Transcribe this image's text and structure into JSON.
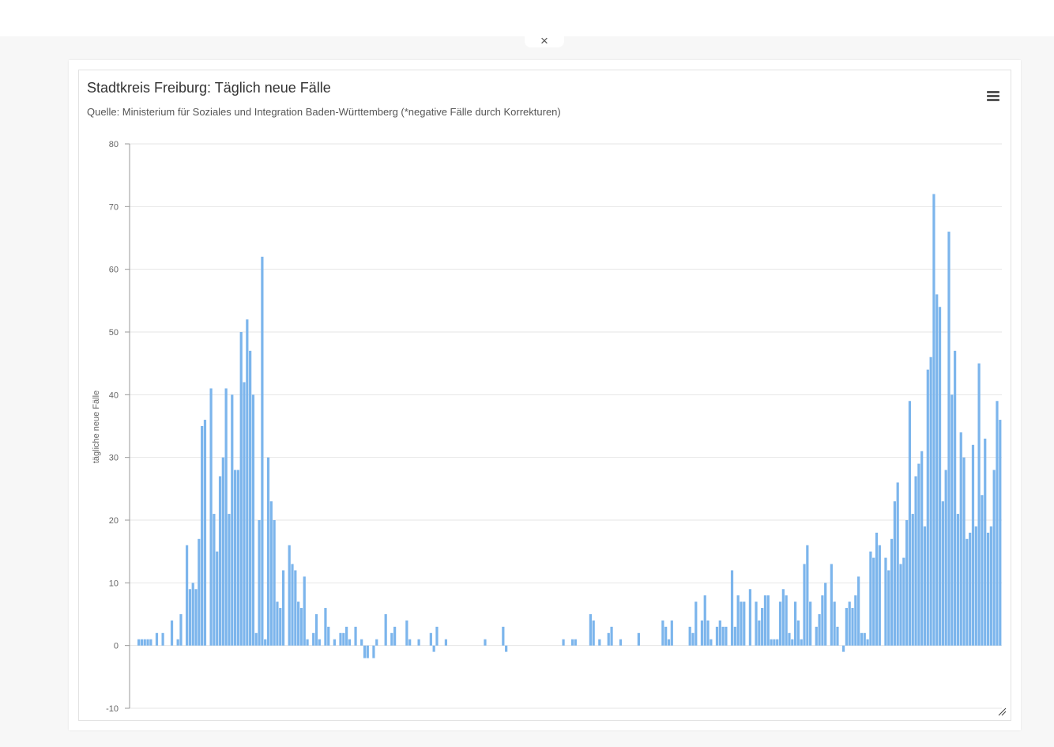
{
  "window": {
    "close_label": "×"
  },
  "menu": {
    "icon": "hamburger-menu-icon"
  },
  "colors": {
    "bar": "#7cb5ec",
    "grid": "#e6e6e6",
    "axis": "#666666"
  },
  "chart_data": {
    "type": "bar",
    "title": "Stadtkreis Freiburg: Täglich neue Fälle",
    "subtitle": "Quelle: Ministerium für Soziales und Integration Baden-Württemberg (*negative Fälle durch Korrekturen)",
    "ylabel": "tägliche neue Fälle",
    "xlabel": "",
    "ylim": [
      -10,
      80
    ],
    "yticks": [
      -10,
      0,
      10,
      20,
      30,
      40,
      50,
      60,
      70,
      80
    ],
    "grid": true,
    "legend": "none",
    "values": [
      1,
      1,
      1,
      1,
      1,
      0,
      2,
      0,
      2,
      0,
      0,
      4,
      0,
      1,
      5,
      0,
      16,
      9,
      10,
      9,
      17,
      35,
      36,
      0,
      41,
      21,
      15,
      27,
      30,
      41,
      21,
      40,
      28,
      28,
      50,
      42,
      52,
      47,
      40,
      2,
      20,
      62,
      1,
      30,
      23,
      20,
      7,
      6,
      12,
      0,
      16,
      13,
      12,
      7,
      6,
      11,
      1,
      0,
      2,
      5,
      1,
      0,
      6,
      3,
      0,
      1,
      0,
      2,
      2,
      3,
      1,
      0,
      3,
      0,
      1,
      -2,
      -2,
      0,
      -2,
      1,
      0,
      0,
      5,
      0,
      2,
      3,
      0,
      0,
      0,
      4,
      1,
      0,
      0,
      1,
      0,
      0,
      0,
      2,
      -1,
      3,
      0,
      0,
      1,
      0,
      0,
      0,
      0,
      0,
      0,
      0,
      0,
      0,
      0,
      0,
      0,
      1,
      0,
      0,
      0,
      0,
      0,
      3,
      -1,
      0,
      0,
      0,
      0,
      0,
      0,
      0,
      0,
      0,
      0,
      0,
      0,
      0,
      0,
      0,
      0,
      0,
      0,
      1,
      0,
      0,
      1,
      1,
      0,
      0,
      0,
      0,
      5,
      4,
      0,
      1,
      0,
      0,
      2,
      3,
      0,
      0,
      1,
      0,
      0,
      0,
      0,
      0,
      2,
      0,
      0,
      0,
      0,
      0,
      0,
      0,
      4,
      3,
      1,
      4,
      0,
      0,
      0,
      0,
      0,
      3,
      2,
      7,
      0,
      4,
      8,
      4,
      1,
      0,
      3,
      4,
      3,
      3,
      0,
      12,
      3,
      8,
      7,
      7,
      0,
      9,
      0,
      7,
      4,
      6,
      8,
      8,
      1,
      1,
      1,
      7,
      9,
      8,
      2,
      1,
      7,
      4,
      1,
      13,
      16,
      7,
      0,
      3,
      5,
      8,
      10,
      0,
      13,
      7,
      3,
      0,
      -1,
      6,
      7,
      6,
      8,
      11,
      2,
      2,
      1,
      15,
      14,
      18,
      16,
      0,
      14,
      12,
      17,
      23,
      26,
      13,
      14,
      20,
      39,
      21,
      27,
      29,
      31,
      19,
      44,
      46,
      72,
      56,
      54,
      23,
      28,
      66,
      40,
      47,
      21,
      34,
      30,
      17,
      18,
      32,
      19,
      45,
      24,
      33,
      18,
      19,
      28,
      39,
      36
    ]
  }
}
